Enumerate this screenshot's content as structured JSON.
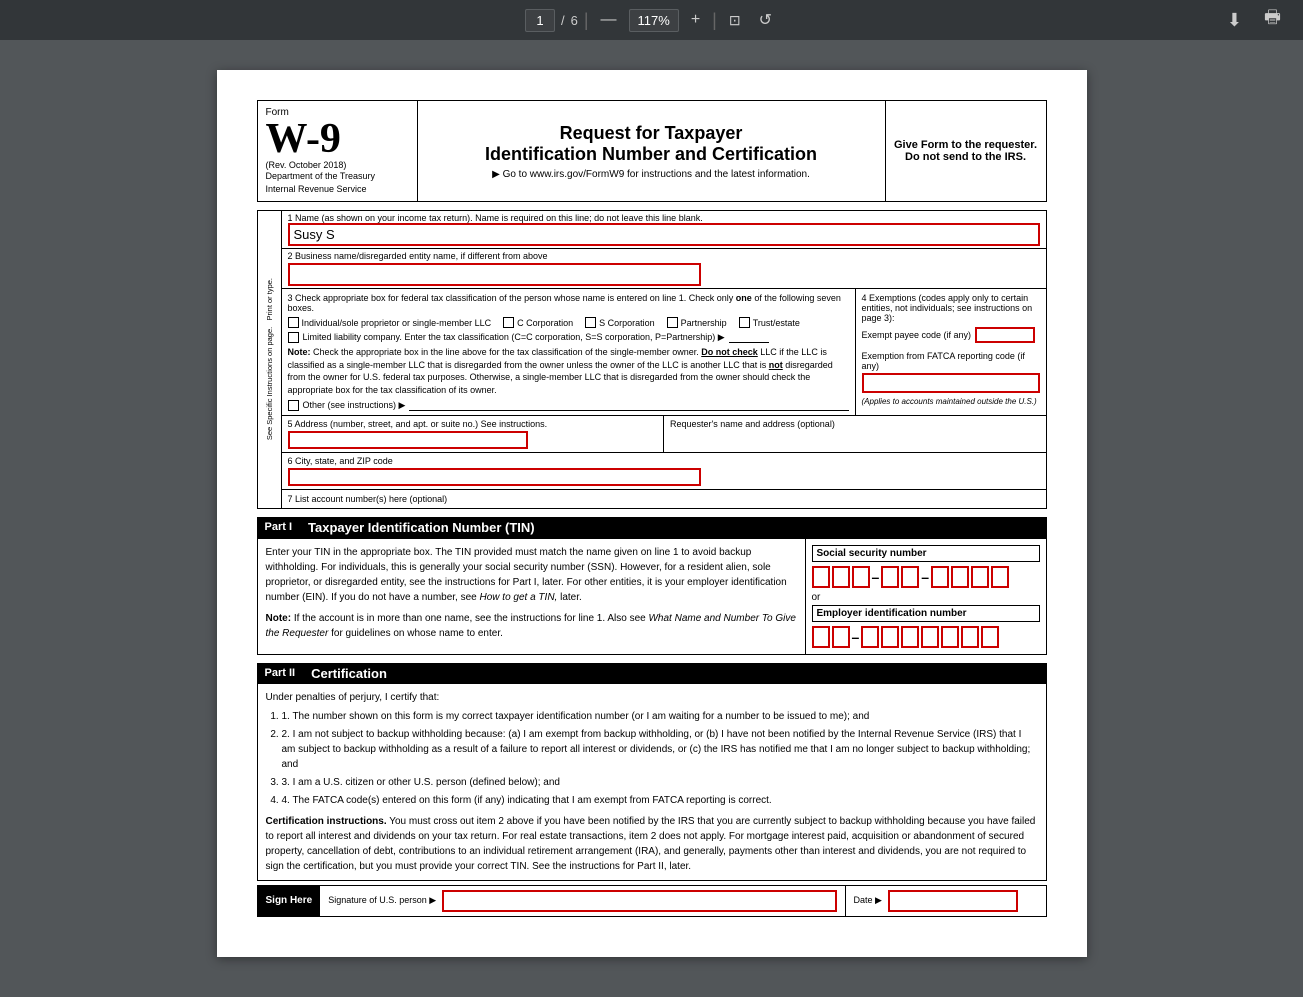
{
  "toolbar": {
    "page_current": "1",
    "page_total": "6",
    "zoom": "117%",
    "download_icon": "⬇",
    "print_icon": "🖶",
    "minus_icon": "—",
    "plus_icon": "+",
    "fit_icon": "⊡",
    "rotate_icon": "↺"
  },
  "form": {
    "form_label": "Form",
    "form_number": "W-9",
    "rev_date": "(Rev. October 2018)",
    "dept": "Department of the Treasury",
    "irs": "Internal Revenue Service",
    "title_main": "Request for Taxpayer",
    "title_sub": "Identification Number and Certification",
    "url_text": "▶ Go to www.irs.gov/FormW9 for instructions and the latest information.",
    "give_form": "Give Form to the requester. Do not send to the IRS.",
    "line1_label": "1  Name (as shown on your income tax return). Name is required on this line; do not leave this line blank.",
    "line1_value": "Susy S",
    "line2_label": "2  Business name/disregarded entity name, if different from above",
    "line3_label": "3  Check appropriate box for federal tax classification of the person whose name is entered on line 1. Check only",
    "line3_label2": "one",
    "line3_label3": "of the following seven boxes.",
    "individual_label": "Individual/sole proprietor or single-member LLC",
    "c_corp_label": "C Corporation",
    "s_corp_label": "S Corporation",
    "partnership_label": "Partnership",
    "trust_label": "Trust/estate",
    "llc_label": "Limited liability company. Enter the tax classification (C=C corporation, S=S corporation, P=Partnership) ▶",
    "note_bold": "Note:",
    "note_text": " Check the appropriate box in the line above for the tax classification of the single-member owner.",
    "do_not_check": "Do not check",
    "note_text2": " LLC if the LLC is classified as a single-member LLC that is disregarded from the owner unless the owner of the LLC is another LLC that is",
    "not_bold": "not",
    "note_text3": " disregarded from the owner for U.S. federal tax purposes. Otherwise, a single-member LLC that is disregarded from the owner should check the appropriate box for the tax classification of its owner.",
    "other_label": "Other (see instructions) ▶",
    "exemptions_title": "4  Exemptions (codes apply only to certain entities, not individuals; see instructions on page 3):",
    "exempt_payee_label": "Exempt payee code (if any)",
    "fatca_label": "Exemption from FATCA reporting code (if any)",
    "fatca_note": "(Applies to accounts maintained outside the U.S.)",
    "line5_label": "5  Address (number, street, and apt. or suite no.) See instructions.",
    "requester_label": "Requester's name and address (optional)",
    "line6_label": "6  City, state, and ZIP code",
    "line7_label": "7  List account number(s) here (optional)",
    "sidebar_text": "See Specific Instructions on page. Print or type.",
    "part1_label": "Part I",
    "part1_title": "Taxpayer Identification Number (TIN)",
    "part1_text1": "Enter your TIN in the appropriate box. The TIN provided must match the name given on line 1 to avoid backup withholding. For individuals, this is generally your social security number (SSN). However, for a resident alien, sole proprietor, or disregarded entity, see the instructions for Part I, later. For other entities, it is your employer identification number (EIN). If you do not have a number, see",
    "part1_italic": "How to get a TIN,",
    "part1_text2": " later.",
    "part1_note_bold": "Note:",
    "part1_note_text": " If the account is in more than one name, see the instructions for line 1. Also see",
    "part1_italic2": "What Name and Number To Give the Requester",
    "part1_note_text2": " for guidelines on whose name to enter.",
    "ssn_label": "Social security number",
    "ein_label": "Employer identification number",
    "or_text": "or",
    "part2_label": "Part II",
    "part2_title": "Certification",
    "under_penalties": "Under penalties of perjury, I certify that:",
    "cert1": "1. The number shown on this form is my correct taxpayer identification number (or I am waiting for a number to be issued to me); and",
    "cert2": "2. I am not subject to backup withholding because: (a) I am exempt from backup withholding, or (b) I have not been notified by the Internal Revenue Service (IRS) that I am subject to backup withholding as a result of a failure to report all interest or dividends, or (c) the IRS has notified me that I am no longer subject to backup withholding; and",
    "cert3": "3. I am a U.S. citizen or other U.S. person (defined below); and",
    "cert4": "4. The FATCA code(s) entered on this form (if any) indicating that I am exempt from FATCA reporting is correct.",
    "cert_instructions_bold": "Certification instructions.",
    "cert_instructions_text": " You must cross out item 2 above if you have been notified by the IRS that you are currently subject to backup withholding because you have failed to report all interest and dividends on your tax return. For real estate transactions, item 2 does not apply. For mortgage interest paid, acquisition or abandonment of secured property, cancellation of debt, contributions to an individual retirement arrangement (IRA), and generally, payments other than interest and dividends, you are not required to sign the certification, but you must provide your correct TIN. See the instructions for Part II, later.",
    "sign_here_label": "Sign Here",
    "sign_sub": "Signature of U.S. person ▶",
    "date_label": "Date ▶",
    "check_only": "Check only",
    "check_only_text": "one",
    "check_only2": "of the following seven boxes."
  }
}
